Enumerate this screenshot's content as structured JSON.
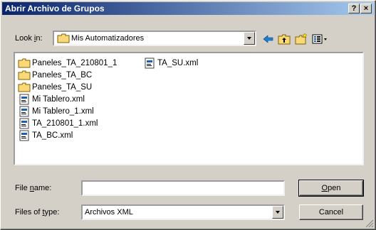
{
  "window": {
    "title": "Abrir Archivo de Grupos",
    "help_glyph": "?",
    "close_glyph": "×"
  },
  "lookin": {
    "label_pre": "Look ",
    "label_key": "i",
    "label_post": "n:",
    "value": "Mis Automatizadores",
    "icon": "folder-icon"
  },
  "toolbar": {
    "icons": [
      "back-arrow-icon",
      "up-folder-icon",
      "new-folder-icon",
      "view-menu-icon"
    ]
  },
  "files": [
    {
      "name": "Paneles_TA_210801_1",
      "icon": "folder-icon"
    },
    {
      "name": "Paneles_TA_BC",
      "icon": "folder-icon"
    },
    {
      "name": "Paneles_TA_SU",
      "icon": "folder-icon"
    },
    {
      "name": "Mi Tablero.xml",
      "icon": "xml-file-icon"
    },
    {
      "name": "Mi Tablero_1.xml",
      "icon": "xml-file-icon"
    },
    {
      "name": "TA_210801_1.xml",
      "icon": "xml-file-icon"
    },
    {
      "name": "TA_BC.xml",
      "icon": "xml-file-icon"
    },
    {
      "name": "TA_SU.xml",
      "icon": "xml-file-icon"
    }
  ],
  "filename": {
    "label_pre": "File ",
    "label_key": "n",
    "label_post": "ame:",
    "value": ""
  },
  "filetype": {
    "label_pre": "Files of ",
    "label_key": "t",
    "label_post": "ype:",
    "value": "Archivos XML"
  },
  "buttons": {
    "open_key": "O",
    "open_rest": "pen",
    "cancel": "Cancel"
  },
  "colors": {
    "titlebar_start": "#0a246a",
    "titlebar_end": "#a6caf0",
    "face": "#d4d0c8",
    "folder": "#f8d878"
  }
}
